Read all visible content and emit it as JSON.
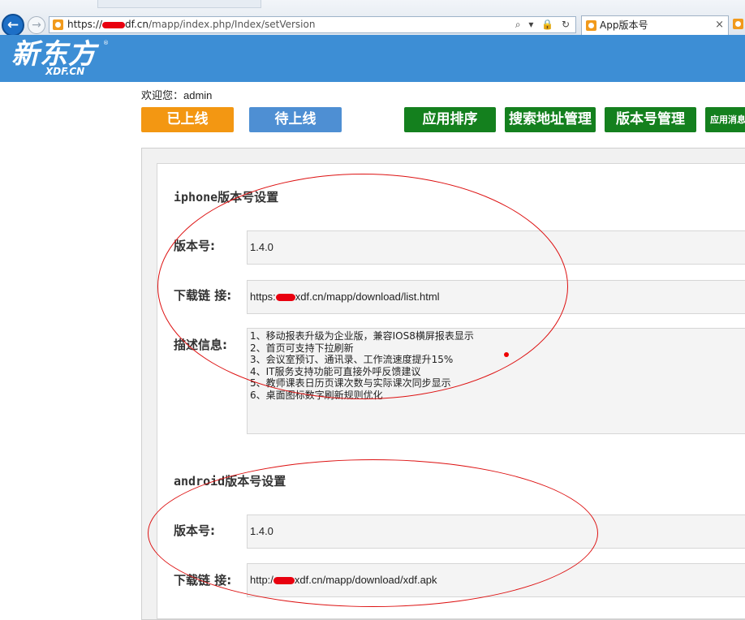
{
  "browser": {
    "address": {
      "url_prefix": "https://",
      "url_host": "df.cn",
      "url_path": "/mapp/index.php/Index/setVersion"
    },
    "address_icons": "⌕ ▾ 🔒 ↻",
    "tab": {
      "title": "App版本号",
      "close": "×"
    }
  },
  "header": {
    "logo_text": "新东方",
    "logo_sub": "XDF.CN",
    "logo_tm": "®"
  },
  "toolbar": {
    "welcome": "欢迎您：admin",
    "online_label": "已上线",
    "pending_label": "待上线",
    "sort_label": "应用排序",
    "search_label": "搜索地址管理",
    "version_label": "版本号管理",
    "message_label": "应用消息"
  },
  "iphone": {
    "section_title": "iphone版本号设置",
    "version_label": "版本号:",
    "version_value": "1.4.0",
    "download_label": "下载链 接:",
    "download_prefix": "https:",
    "download_suffix": "xdf.cn/mapp/download/list.html",
    "desc_label": "描述信息:",
    "desc_lines": [
      "1、移动报表升级为企业版，兼容IOS8横屏报表显示",
      "2、首页可支持下拉刷新",
      "3、会议室预订、通讯录、工作流速度提升15%",
      "4、IT服务支持功能可直接外呼反馈建议",
      "5、教师课表日历页课次数与实际课次同步显示",
      "6、桌面图标数字刷新规则优化"
    ]
  },
  "android": {
    "section_title": "android版本号设置",
    "version_label": "版本号:",
    "version_value": "1.4.0",
    "download_label": "下载链 接:",
    "download_prefix": "http:/",
    "download_suffix": "xdf.cn/mapp/download/xdf.apk"
  },
  "colors": {
    "header_blue": "#3d8ed5",
    "online_orange": "#f39712",
    "pending_blue": "#4e8fd3",
    "manage_green": "#14801e",
    "annotation_red": "#d11111",
    "redaction_red": "#e8000f"
  }
}
